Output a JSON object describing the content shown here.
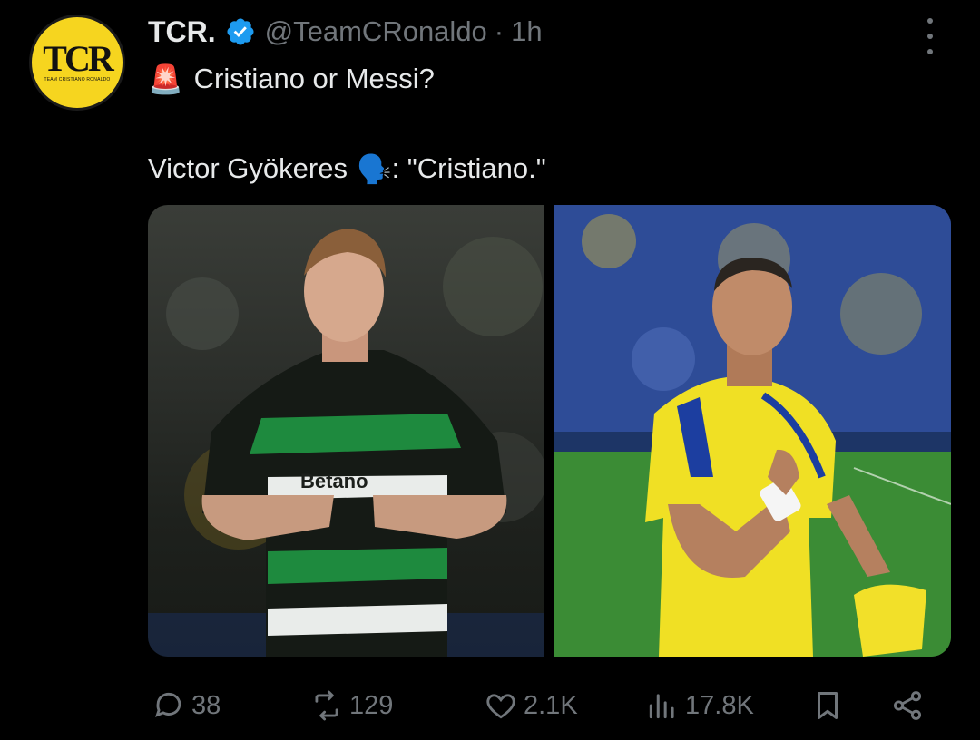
{
  "tweet": {
    "author": {
      "name": "TCR.",
      "handle": "@TeamCRonaldo",
      "time": "1h",
      "separator": "·",
      "avatar_logo": "TCR",
      "avatar_sub": "TEAM CRISTIANO RONALDO",
      "verified": true
    },
    "line1": "Cristiano or Messi?",
    "line1_emoji": "🚨",
    "line2_prefix": "Victor Gyökeres",
    "line2_emoji": "🗣️",
    "line2_suffix": ": \"Cristiano.\"",
    "media": [
      {
        "subject": "player-in-sporting-kit",
        "kit_text": "Betano"
      },
      {
        "subject": "player-in-al-nassr-kit"
      }
    ]
  },
  "actions": {
    "replies": "38",
    "reposts": "129",
    "likes": "2.1K",
    "views": "17.8K"
  },
  "colors": {
    "background": "#000000",
    "text": "#e7e9ea",
    "muted": "#71767b",
    "verified": "#1d9bf0",
    "avatar": "#f6d51f"
  }
}
